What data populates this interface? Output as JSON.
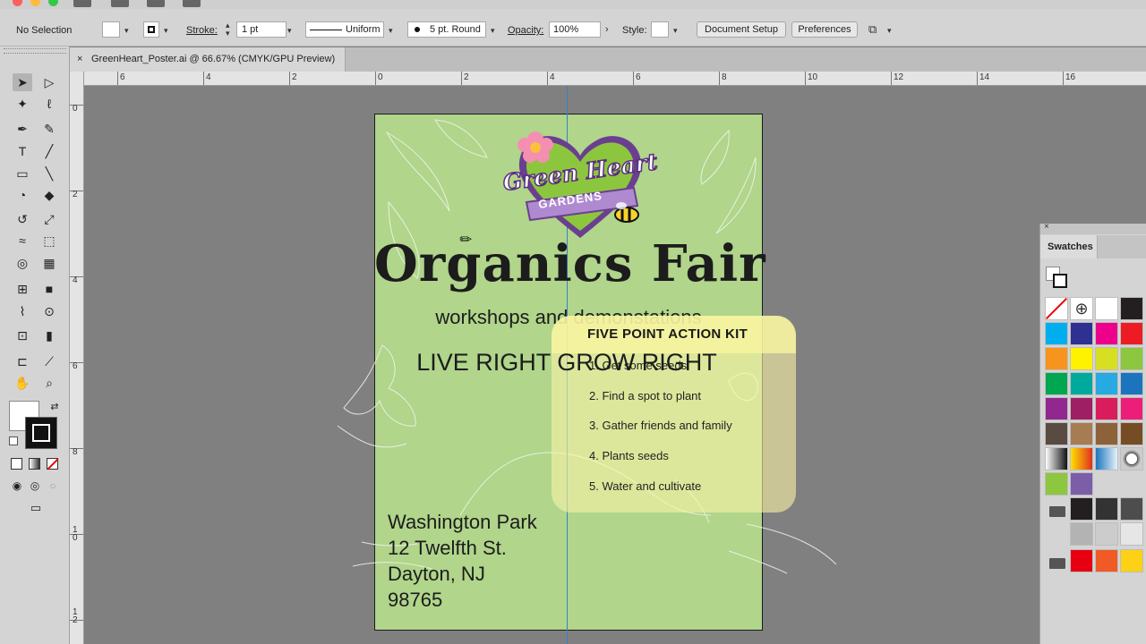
{
  "controlbar": {
    "selection_label": "No Selection",
    "stroke_label": "Stroke:",
    "stroke_value": "1 pt",
    "profile_label": "Uniform",
    "brush_label": "5 pt. Round",
    "opacity_label": "Opacity:",
    "opacity_value": "100%",
    "style_label": "Style:",
    "document_setup_label": "Document Setup",
    "preferences_label": "Preferences"
  },
  "document_tab": {
    "title": "GreenHeart_Poster.ai @ 66.67% (CMYK/GPU Preview)",
    "close": "×"
  },
  "rulers": {
    "horizontal": [
      "6",
      "4",
      "2",
      "0",
      "2",
      "4",
      "6",
      "8",
      "10",
      "12",
      "14",
      "16"
    ],
    "vertical": [
      "0",
      "2",
      "4",
      "6",
      "8",
      "1\n0",
      "1\n2"
    ]
  },
  "poster": {
    "logo_line1": "Green Heart",
    "logo_line2": "GARDENS",
    "title": "Organics Fair",
    "subtitle": "workshops and demonstations",
    "tagline": "LIVE RIGHT GROW RIGHT",
    "kit_title": "FIVE POINT ACTION KIT",
    "kit_items": [
      "1. Get some seeds",
      "2. Find a spot to plant",
      "3. Gather friends and family",
      "4. Plants seeds",
      "5. Water and cultivate"
    ],
    "address": [
      "Washington Park",
      "12 Twelfth St.",
      "Dayton, NJ",
      "98765"
    ]
  },
  "swatches_panel": {
    "title": "Swatches",
    "close": "×",
    "colors": [
      [
        "none",
        "registration",
        "#ffffff",
        "#231f20"
      ],
      [
        "#00aeef",
        "#2e3192",
        "#ec008c",
        "#ed1c24"
      ],
      [
        "#f7941d",
        "#fff200",
        "#d7df23",
        "#8dc63f"
      ],
      [
        "#00a651",
        "#00a99d",
        "#27aae1",
        "#1c75bc"
      ],
      [
        "#92278f",
        "#9e1f63",
        "#d91c5c",
        "#ed1e79"
      ],
      [
        "#594a42",
        "#a67c52",
        "#8c6239",
        "#754c24"
      ],
      [
        "gradient-gray",
        "gradient-orange",
        "gradient-blue",
        "pattern"
      ],
      [
        "#8dc63f",
        "#7b5ea7"
      ],
      [
        "#231f20",
        "#333333",
        "#4d4d4d"
      ],
      [
        "#b3b3b3",
        "#cccccc",
        "#e6e6e6"
      ],
      [
        "#e60012",
        "#f15a24",
        "#fcd116"
      ]
    ]
  }
}
